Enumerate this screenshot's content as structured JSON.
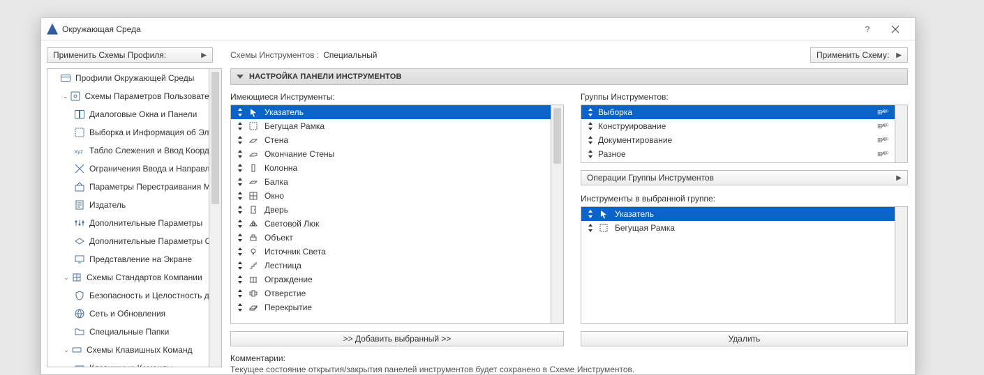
{
  "window": {
    "title": "Окружающая Среда"
  },
  "left": {
    "apply_profile_label": "Применить Схемы Профиля:",
    "tree": {
      "root": "Профили Окружающей Среды",
      "group_user": "Схемы Параметров Пользователя",
      "items_user": {
        "dialogs": "Диалоговые Окна и Панели",
        "selection": "Выборка и Информация об Элементах",
        "tracker": "Табло Слежения и Ввод Координат",
        "constraints": "Ограничения Ввода и Направляющие",
        "rebuild": "Параметры Перестраивания Модели",
        "publisher": "Издатель",
        "extra_params": "Дополнительные Параметры",
        "extra_params_o": "Дополнительные Параметры Объекта",
        "onscreen": "Представление на Экране"
      },
      "group_company": "Схемы Стандартов Компании",
      "items_company": {
        "security": "Безопасность и Целостность данных",
        "network": "Сеть и Обновления",
        "folders": "Специальные Папки"
      },
      "group_shortcuts": "Схемы Клавишных Команд",
      "items_shortcuts": {
        "commands": "Клавишные Команды"
      }
    }
  },
  "right": {
    "schemes_label": "Схемы Инструментов :",
    "schemes_value": "Специальный",
    "apply_scheme_label": "Применить Схему:",
    "section_title": "Настройка панели инструментов",
    "available_label": "Имеющиеся Инструменты:",
    "groups_label": "Группы Инструментов:",
    "ingroup_label": "Инструменты в выбранной группе:",
    "group_ops_label": "Операции Группы Инструментов",
    "add_selected_label": ">>   Добавить выбранный   >>",
    "delete_label": "Удалить",
    "comments_label": "Комментарии:",
    "comments_body": "Текущее состояние открытия/закрытия панелей инструментов будет сохранено в Схеме Инструментов.",
    "tools": {
      "pointer": "Указатель",
      "marquee": "Бегущая Рамка",
      "wall": "Стена",
      "wallend": "Окончание Стены",
      "column": "Колонна",
      "beam": "Балка",
      "window": "Окно",
      "door": "Дверь",
      "skylight": "Световой Люк",
      "object": "Объект",
      "light": "Источник Света",
      "stair": "Лестница",
      "railing": "Ограждение",
      "opening": "Отверстие",
      "slab": "Перекрытие"
    },
    "groups": {
      "selection": "Выборка",
      "construct": "Конструирование",
      "document": "Документирование",
      "misc": "Разное"
    },
    "group_tags": {
      "selection": "⊞ᴬᴮ⁰",
      "construct": "⊞ᴬᴮ⁰",
      "document": "⊞ᴬᴮ⁰",
      "misc": "⊞ᴬᴮ⁰"
    },
    "ingroup": {
      "pointer": "Указатель",
      "marquee": "Бегущая Рамка"
    }
  }
}
